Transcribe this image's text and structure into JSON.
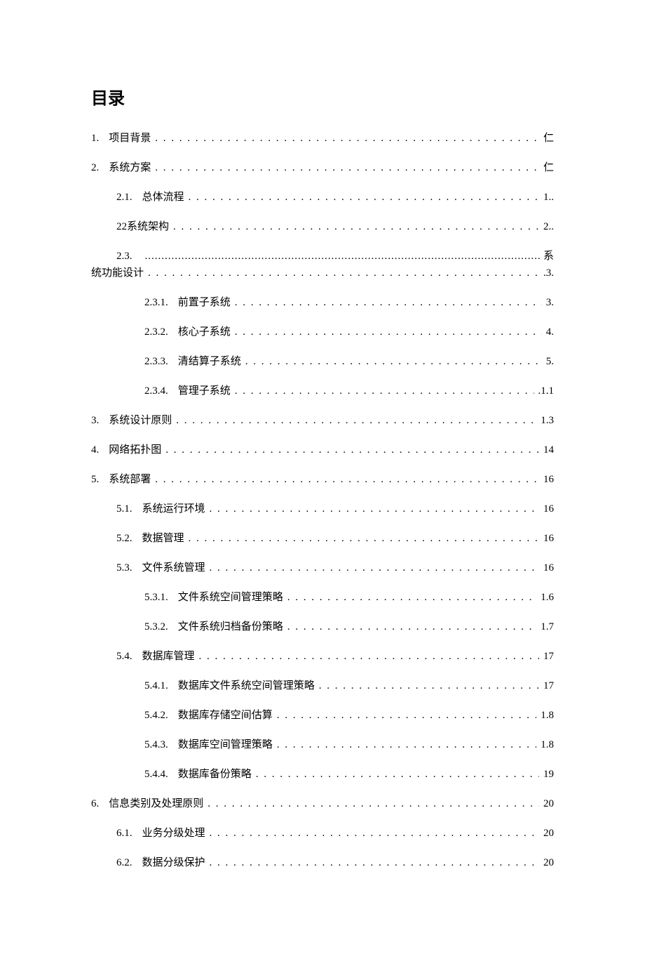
{
  "title": "目录",
  "entries": [
    {
      "level": 0,
      "num": "1.",
      "text": "项目背景",
      "page": "仁"
    },
    {
      "level": 0,
      "num": "2.",
      "text": "系统方案",
      "page": "仁"
    },
    {
      "level": 1,
      "num": "2.1.",
      "text": "总体流程",
      "page": "1.."
    },
    {
      "level": 1,
      "num": "",
      "text": "22系统架构",
      "page": "2.."
    }
  ],
  "special23": {
    "num": "2.3.",
    "tail1": "系",
    "text2": "统功能设计",
    "page": ".3."
  },
  "entries2": [
    {
      "level": 2,
      "num": "2.3.1.",
      "text": "前置子系统",
      "page": "3."
    },
    {
      "level": 2,
      "num": "2.3.2.",
      "text": "核心子系统",
      "page": "4."
    },
    {
      "level": 2,
      "num": "2.3.3.",
      "text": "清结算子系统",
      "page": "5."
    },
    {
      "level": 2,
      "num": "2.3.4.",
      "text": "管理子系统",
      "page": ".1.1"
    },
    {
      "level": 0,
      "num": "3.",
      "text": "系统设计原则",
      "page": "1.3"
    },
    {
      "level": 0,
      "num": "4.",
      "text": "网络拓扑图",
      "page": "14"
    },
    {
      "level": 0,
      "num": "5.",
      "text": "系统部署",
      "page": "16"
    },
    {
      "level": 1,
      "num": "5.1.",
      "text": "系统运行环境",
      "page": "16"
    },
    {
      "level": 1,
      "num": "5.2.",
      "text": "数据管理",
      "page": "16"
    },
    {
      "level": 1,
      "num": "5.3.",
      "text": "文件系统管理",
      "page": "16"
    },
    {
      "level": 2,
      "num": "5.3.1.",
      "text": "文件系统空间管理策略",
      "page": "1.6"
    },
    {
      "level": 2,
      "num": "5.3.2.",
      "text": "文件系统归档备份策略",
      "page": "1.7"
    },
    {
      "level": 1,
      "num": "5.4.",
      "text": "数据库管理",
      "page": "17"
    },
    {
      "level": 2,
      "num": "5.4.1.",
      "text": "数据库文件系统空间管理策略",
      "page": "17"
    },
    {
      "level": 2,
      "num": "5.4.2.",
      "text": "数据库存储空间估算",
      "page": "1.8"
    },
    {
      "level": 2,
      "num": "5.4.3.",
      "text": "数据库空间管理策略",
      "page": "1.8"
    },
    {
      "level": 2,
      "num": "5.4.4.",
      "text": "数据库备份策略",
      "page": "19"
    },
    {
      "level": 0,
      "num": "6.",
      "text": "信息类别及处理原则",
      "page": "20"
    },
    {
      "level": 1,
      "num": "6.1.",
      "text": "业务分级处理",
      "page": "20"
    },
    {
      "level": 1,
      "num": "6.2.",
      "text": "数据分级保护",
      "page": "20"
    }
  ]
}
